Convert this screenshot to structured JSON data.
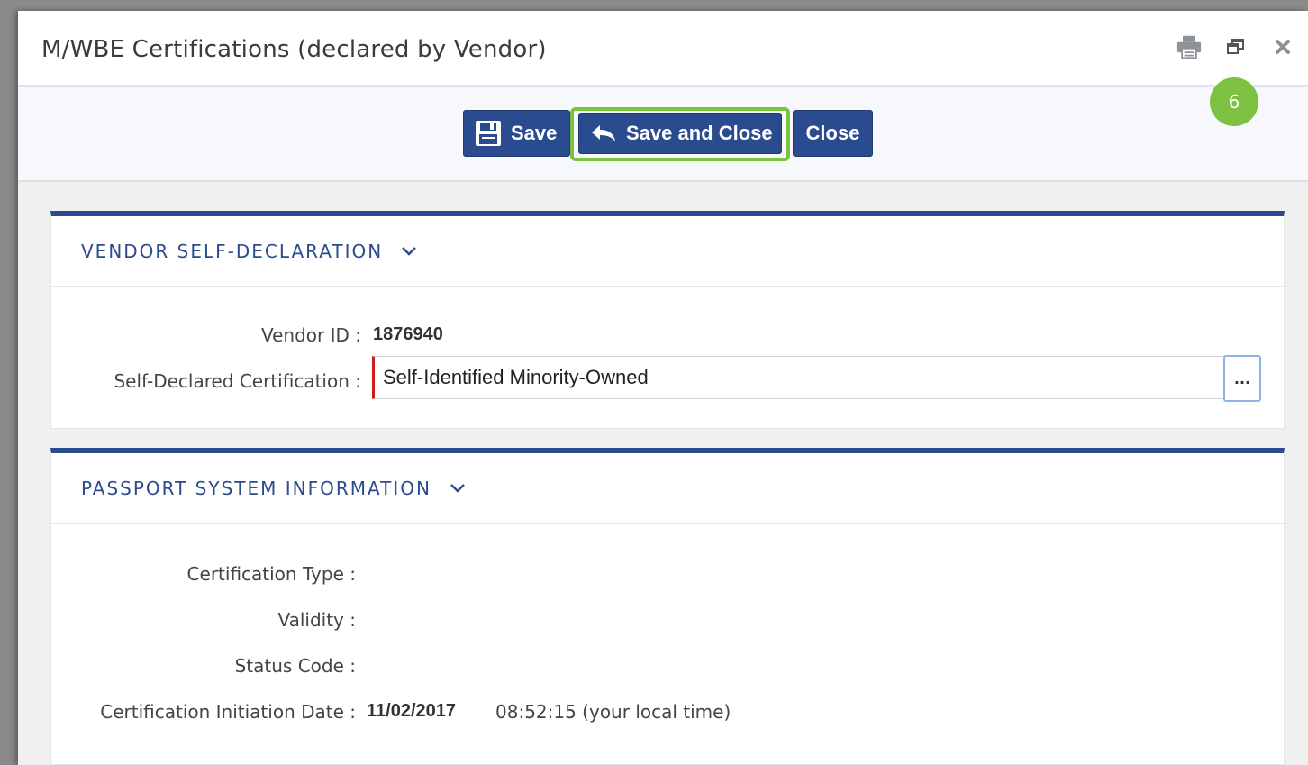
{
  "window": {
    "title": "M/WBE Certifications (declared by Vendor)",
    "icons": [
      "print-icon",
      "restore-window-icon",
      "close-window-icon"
    ]
  },
  "toolbar": {
    "save_label": "Save",
    "save_and_close_label": "Save and Close",
    "close_label": "Close",
    "step_badge": "6"
  },
  "vendor_section": {
    "title": "VENDOR SELF-DECLARATION",
    "vendor_id_label": "Vendor ID :",
    "vendor_id_value": "1876940",
    "certification_label": "Self-Declared Certification :",
    "certification_value": "Self-Identified Minority-Owned",
    "lookup_button": "..."
  },
  "passport_section": {
    "title": "PASSPORT SYSTEM INFORMATION",
    "certification_type_label": "Certification Type :",
    "validity_label": "Validity :",
    "status_code_label": "Status Code :",
    "initiation_date_label": "Certification Initiation Date :",
    "initiation_date_value": "11/02/2017",
    "initiation_time_value": "08:52:15 (your local time)"
  },
  "colors": {
    "primary": "#2b4b8f",
    "highlight": "#7cc142",
    "required": "#d11a1a"
  }
}
